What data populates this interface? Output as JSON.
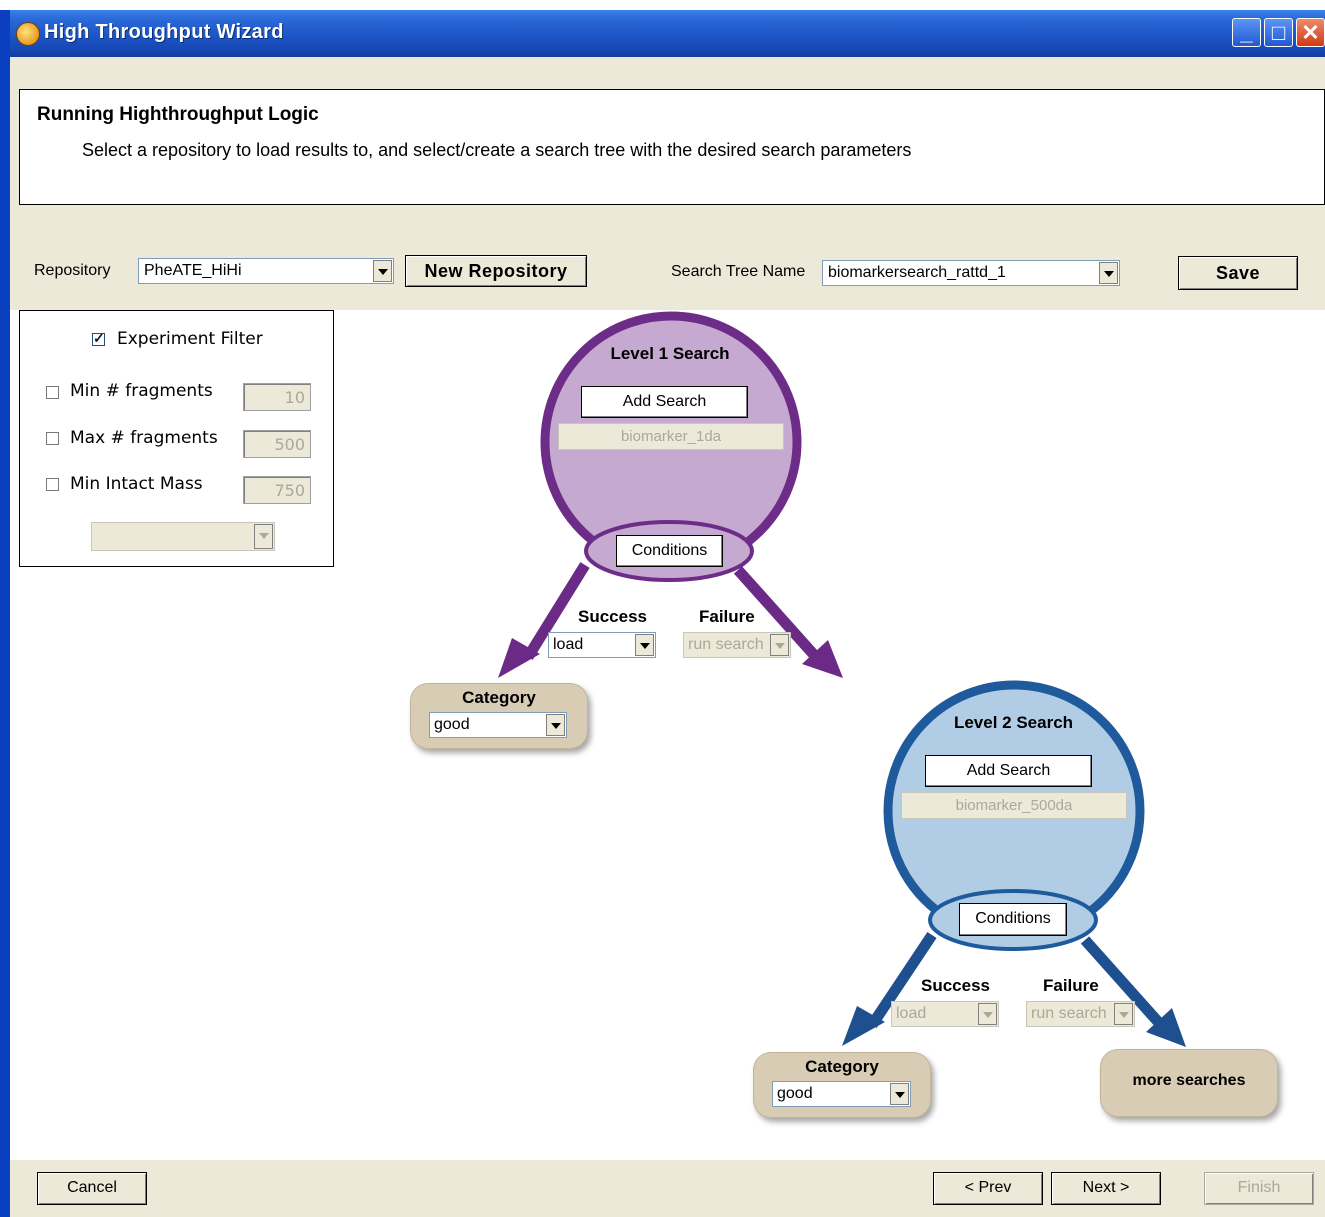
{
  "window": {
    "title": "High Throughput Wizard",
    "controls": {
      "minimize": "minimize-icon",
      "maximize": "maximize-icon",
      "close": "close-icon"
    }
  },
  "header": {
    "title": "Running Highthroughput Logic",
    "subtitle": "Select a repository to load results to, and select/create a search tree with the desired search parameters"
  },
  "toolbar": {
    "repository_label": "Repository",
    "repository_value": "PheATE_HiHi",
    "new_repository_label": "New Repository",
    "search_tree_label": "Search Tree Name",
    "search_tree_value": "biomarkersearch_rattd_1",
    "save_label": "Save"
  },
  "filter": {
    "experiment_filter_label": "Experiment Filter",
    "experiment_filter_checked": true,
    "min_fragments_label": "Min # fragments",
    "min_fragments_value": "10",
    "max_fragments_label": "Max # fragments",
    "max_fragments_value": "500",
    "min_intact_mass_label": "Min Intact Mass",
    "min_intact_mass_value": "750",
    "extra_select_value": ""
  },
  "level1": {
    "title": "Level 1 Search",
    "add_search_label": "Add Search",
    "search_name": "biomarker_1da",
    "conditions_label": "Conditions",
    "success_label": "Success",
    "success_value": "load",
    "failure_label": "Failure",
    "failure_value": "run search",
    "category_title": "Category",
    "category_value": "good",
    "color": "#7b2f92",
    "fill": "#c6a9d0"
  },
  "level2": {
    "title": "Level 2 Search",
    "add_search_label": "Add Search",
    "search_name": "biomarker_500da",
    "conditions_label": "Conditions",
    "success_label": "Success",
    "success_value": "load",
    "failure_label": "Failure",
    "failure_value": "run search",
    "category_title": "Category",
    "category_value": "good",
    "more_searches_label": "more searches",
    "color": "#1e5a9c",
    "fill": "#b1cde6"
  },
  "footer": {
    "cancel_label": "Cancel",
    "prev_label": "< Prev",
    "next_label": "Next >",
    "finish_label": "Finish"
  }
}
